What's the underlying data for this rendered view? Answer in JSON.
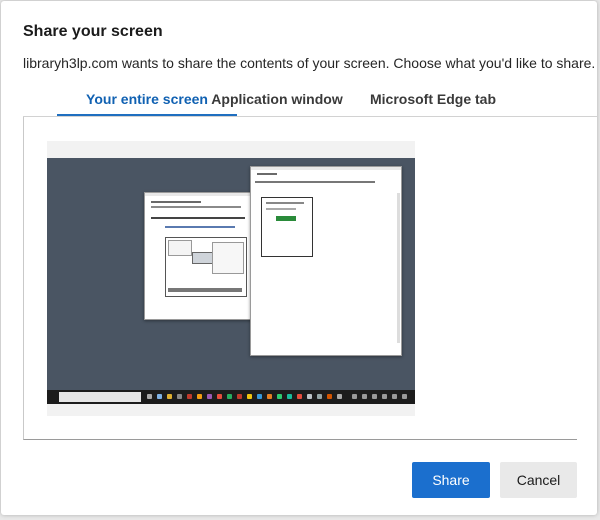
{
  "dialog": {
    "title": "Share your screen",
    "description": "libraryh3lp.com wants to share the contents of your screen. Choose what you'd like to share."
  },
  "tabs": [
    {
      "label": "Your entire screen",
      "active": true
    },
    {
      "label": "Application window",
      "active": false
    },
    {
      "label": "Microsoft Edge tab",
      "active": false
    }
  ],
  "preview": {
    "icon": "screen-thumbnail"
  },
  "buttons": {
    "share": "Share",
    "cancel": "Cancel"
  },
  "colors": {
    "accent": "#1b6fce",
    "active_tab": "#1061b2",
    "desktop": "#4a5563"
  }
}
